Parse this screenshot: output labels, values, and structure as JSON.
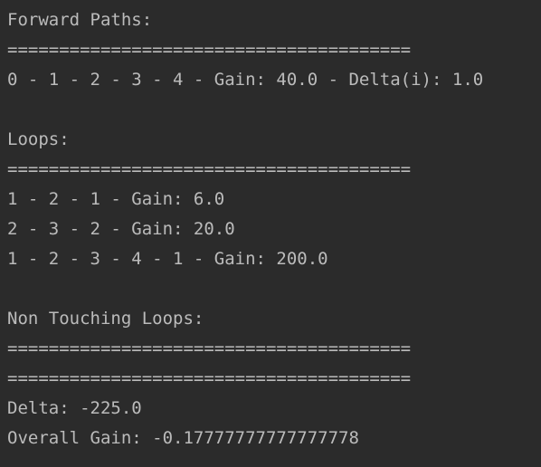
{
  "console": {
    "lines": [
      "Forward Paths:",
      "=======================================",
      "0 - 1 - 2 - 3 - 4 - Gain: 40.0 - Delta(i): 1.0",
      "",
      "Loops:",
      "=======================================",
      "1 - 2 - 1 - Gain: 6.0",
      "2 - 3 - 2 - Gain: 20.0",
      "1 - 2 - 3 - 4 - 1 - Gain: 200.0",
      "",
      "Non Touching Loops:",
      "=======================================",
      "=======================================",
      "Delta: -225.0",
      "Overall Gain: -0.17777777777777778"
    ]
  }
}
